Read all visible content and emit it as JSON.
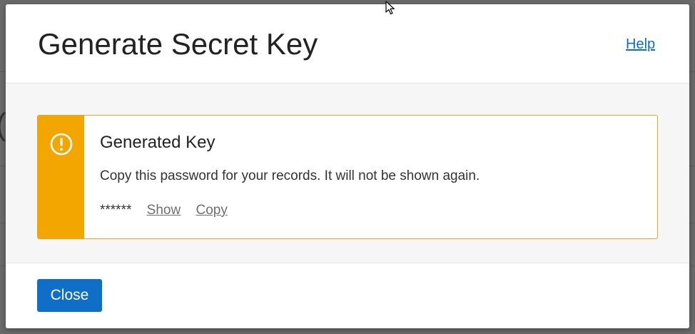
{
  "dialog": {
    "title": "Generate Secret Key",
    "help_label": "Help",
    "alert": {
      "title": "Generated Key",
      "message": "Copy this password for your records. It will not be shown again.",
      "masked_key": "******",
      "show_label": "Show",
      "copy_label": "Copy",
      "icon": "exclamation-circle-icon",
      "accent_color": "#f4a600"
    },
    "close_label": "Close"
  },
  "colors": {
    "primary": "#0f6fc6",
    "warning": "#f4a600",
    "overlay": "#6a6a6a"
  }
}
